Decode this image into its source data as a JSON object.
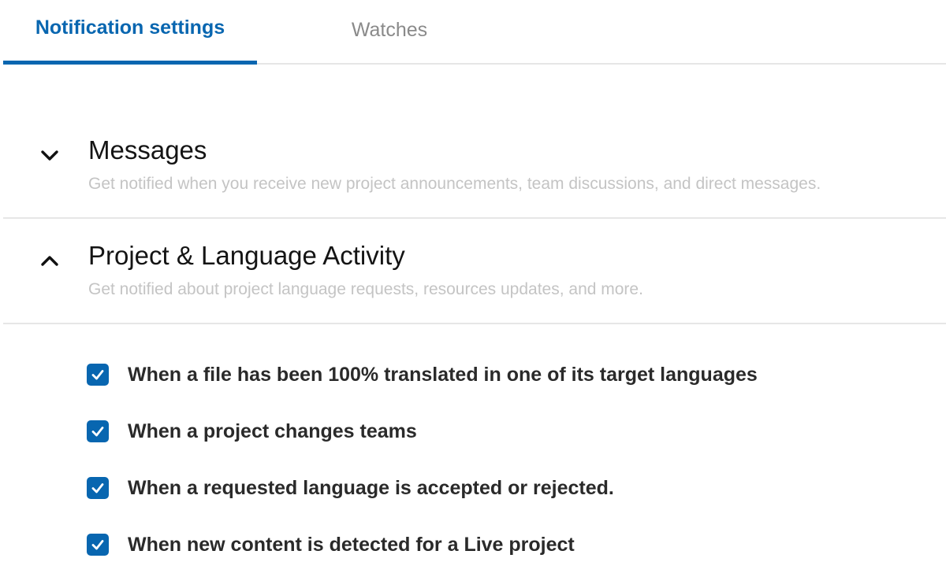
{
  "tabs": [
    {
      "label": "Notification settings",
      "active": true
    },
    {
      "label": "Watches",
      "active": false
    }
  ],
  "sections": [
    {
      "title": "Messages",
      "description": "Get notified when you receive new project announcements, team discussions, and direct messages.",
      "expanded": false,
      "icon": "chevron-down-icon"
    },
    {
      "title": "Project & Language Activity",
      "description": "Get notified about project language requests, resources updates, and more.",
      "expanded": true,
      "icon": "chevron-up-icon"
    }
  ],
  "options": [
    {
      "label": "When a file has been 100% translated in one of its target languages",
      "checked": true
    },
    {
      "label": "When a project changes teams",
      "checked": true
    },
    {
      "label": "When a requested language is accepted or rejected.",
      "checked": true
    },
    {
      "label": "When new content is detected for a Live project",
      "checked": true
    }
  ],
  "colors": {
    "accent": "#0866b0",
    "inactive_tab": "#8a8a8a",
    "description": "#c4c4c4",
    "divider": "#e6e6e6"
  }
}
